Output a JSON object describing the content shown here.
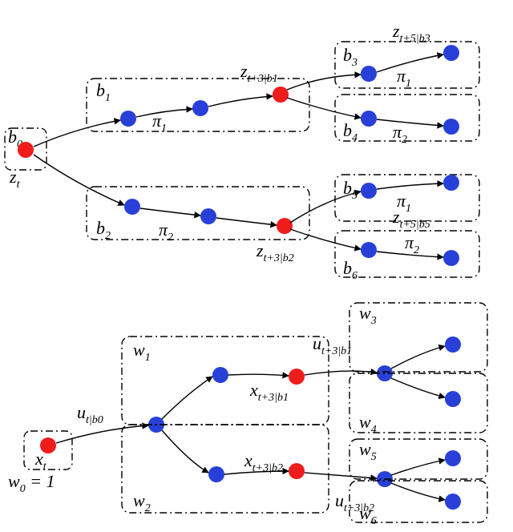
{
  "diagram": {
    "top": {
      "root_box_label": "b0",
      "root_state": "zt",
      "b1": {
        "label": "b1",
        "policy": "π1",
        "end_state": "zt+3|b1"
      },
      "b2": {
        "label": "b2",
        "policy": "π2",
        "end_state": "zt+3|b2"
      },
      "b3": {
        "label": "b3",
        "policy": "π1",
        "end_state": "zt+5|b3"
      },
      "b4": {
        "label": "b4",
        "policy": "π2"
      },
      "b5": {
        "label": "b5",
        "policy": "π1",
        "end_state": "zt+5|b5"
      },
      "b6": {
        "label": "b6",
        "policy": "π2"
      }
    },
    "bottom": {
      "root_weight": "w0 = 1",
      "root_state": "xt",
      "root_control": "ut|b0",
      "w1": {
        "label": "w1",
        "end_state": "xt+3|b1",
        "control": "ut+3|b1"
      },
      "w2": {
        "label": "w2",
        "end_state": "xt+3|b2",
        "control": "ut+3|b2"
      },
      "w3": {
        "label": "w3"
      },
      "w4": {
        "label": "w4"
      },
      "w5": {
        "label": "w5"
      },
      "w6": {
        "label": "w6"
      }
    }
  },
  "chart_data": {
    "type": "tree",
    "description": "Two policy/trajectory trees",
    "upper_tree": {
      "root": {
        "box": "b0",
        "state": "z_t",
        "color": "red"
      },
      "branches": [
        {
          "box": "b1",
          "policy": "pi_1",
          "steps": 3,
          "end_state": "z_{t+3|b1}",
          "end_color": "red",
          "children": [
            {
              "box": "b3",
              "policy": "pi_1",
              "steps": 2,
              "end_state": "z_{t+5|b3}",
              "end_color": "blue"
            },
            {
              "box": "b4",
              "policy": "pi_2",
              "steps": 2,
              "end_color": "blue"
            }
          ]
        },
        {
          "box": "b2",
          "policy": "pi_2",
          "steps": 3,
          "end_state": "z_{t+3|b2}",
          "end_color": "red",
          "children": [
            {
              "box": "b5",
              "policy": "pi_1",
              "steps": 2,
              "end_state": "z_{t+5|b5}",
              "end_color": "blue"
            },
            {
              "box": "b6",
              "policy": "pi_2",
              "steps": 2,
              "end_color": "blue"
            }
          ]
        }
      ]
    },
    "lower_tree": {
      "root": {
        "weight": "w0=1",
        "state": "x_t",
        "control": "u_{t|b0}",
        "color": "red"
      },
      "branches": [
        {
          "box": "w1",
          "end_state": "x_{t+3|b1}",
          "control": "u_{t+3|b1}",
          "end_color": "red",
          "children": [
            {
              "box": "w3"
            },
            {
              "box": "w4"
            }
          ]
        },
        {
          "box": "w2",
          "end_state": "x_{t+3|b2}",
          "control": "u_{t+3|b2}",
          "end_color": "red",
          "children": [
            {
              "box": "w5"
            },
            {
              "box": "w6"
            }
          ]
        }
      ]
    }
  }
}
